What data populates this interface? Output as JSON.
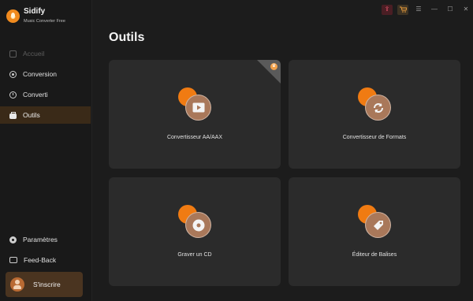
{
  "app": {
    "name": "Sidify",
    "subtitle": "Music Converter Free"
  },
  "sidebar": {
    "items": [
      {
        "label": "Accueil",
        "state": "disabled",
        "icon": "home-icon"
      },
      {
        "label": "Conversion",
        "state": "normal",
        "icon": "disc-icon"
      },
      {
        "label": "Converti",
        "state": "normal",
        "icon": "clock-icon"
      },
      {
        "label": "Outils",
        "state": "active",
        "icon": "toolbox-icon"
      }
    ],
    "bottom_items": [
      {
        "label": "Paramètres",
        "icon": "gear-icon"
      },
      {
        "label": "Feed-Back",
        "icon": "mail-icon"
      }
    ],
    "signin_label": "S'inscrire"
  },
  "topbar": {
    "icons": [
      "upgrade-icon",
      "cart-icon",
      "menu-icon",
      "minimize-icon",
      "maximize-icon",
      "close-icon"
    ],
    "glyphs": [
      "⇪",
      "🛒",
      "☰",
      "—",
      "☐",
      "✕"
    ]
  },
  "main": {
    "title": "Outils",
    "tools": [
      {
        "label": "Convertisseur AA/AAX",
        "icon": "play-file-icon",
        "glyph": "▶",
        "premium": true
      },
      {
        "label": "Convertisseur de Formats",
        "icon": "convert-icon",
        "glyph": "⟳",
        "premium": false
      },
      {
        "label": "Graver un CD",
        "icon": "cd-icon",
        "glyph": "◉",
        "premium": false
      },
      {
        "label": "Éditeur de Balises",
        "icon": "tag-icon",
        "glyph": "⬧",
        "premium": false
      }
    ]
  },
  "colors": {
    "accent": "#f07b12",
    "sidebar_bg": "#191919",
    "card_bg": "#2b2b2b",
    "active_bg": "#3a2a18"
  }
}
